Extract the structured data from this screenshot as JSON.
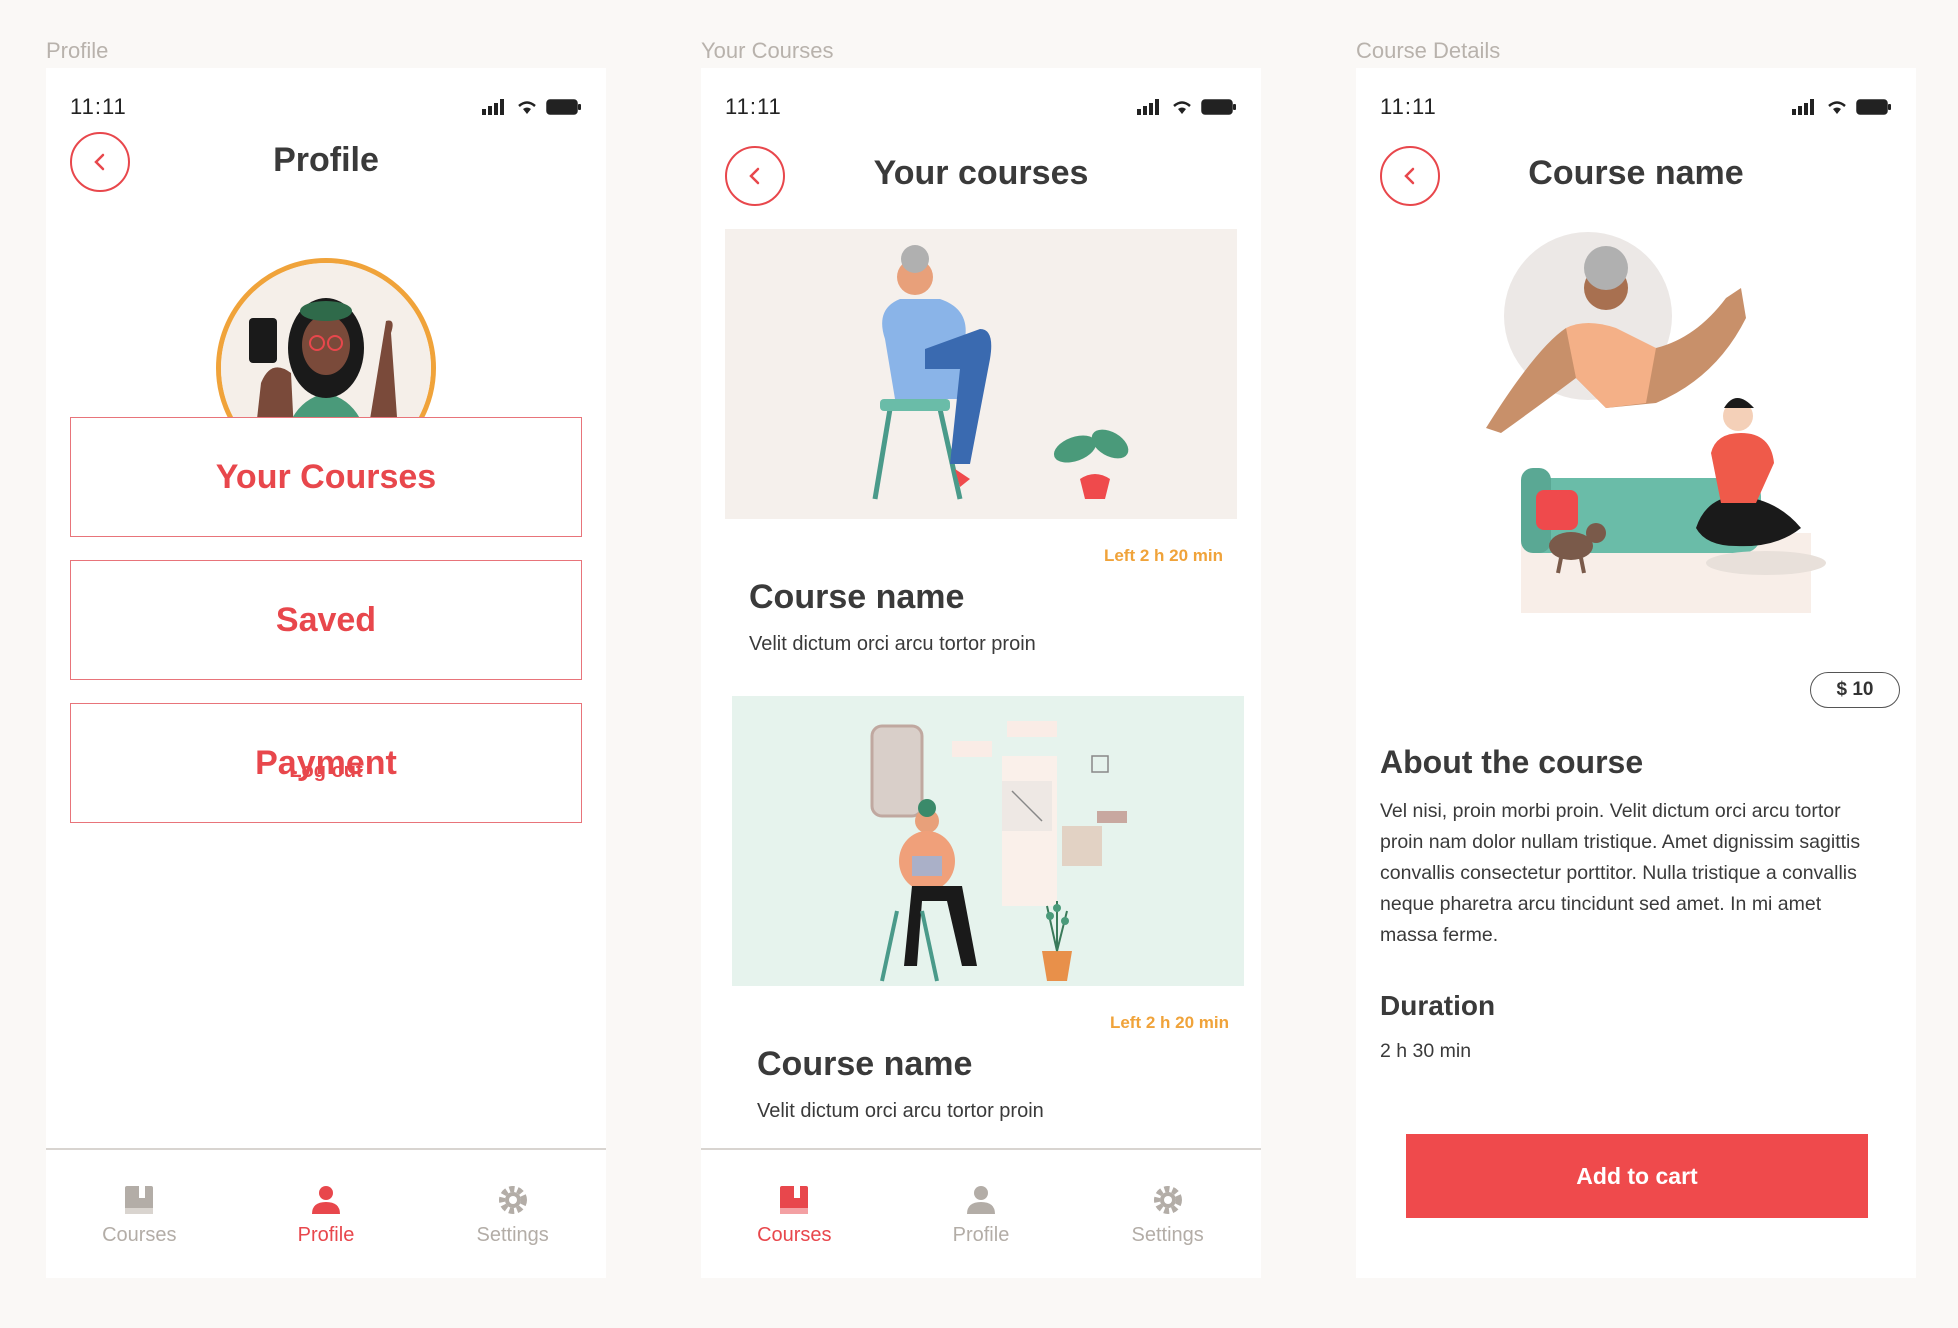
{
  "frames": {
    "profile_label": "Profile",
    "courses_label": "Your Courses",
    "details_label": "Course Details"
  },
  "status": {
    "time": "11:11"
  },
  "profile": {
    "title": "Profile",
    "menu": [
      "Your Courses",
      "Saved",
      "Payment"
    ],
    "logout": "Log out"
  },
  "courses": {
    "title": "Your courses",
    "items": [
      {
        "left": "Left 2 h 20 min",
        "name": "Course name",
        "desc": "Velit dictum orci arcu tortor proin"
      },
      {
        "left": "Left 2 h 20 min",
        "name": "Course name",
        "desc": "Velit dictum orci arcu tortor proin"
      }
    ]
  },
  "details": {
    "title": "Course name",
    "price": "$ 10",
    "about_heading": "About the course",
    "about_text": "Vel nisi, proin morbi proin. Velit dictum orci arcu tortor proin nam dolor nullam tristique. Amet dignissim sagittis convallis consectetur porttitor. Nulla tristique a convallis neque pharetra arcu tincidunt sed amet. In mi amet massa ferme.",
    "duration_heading": "Duration",
    "duration_value": "2 h 30 min",
    "cart_button": "Add to cart"
  },
  "tabs": {
    "courses": "Courses",
    "profile": "Profile",
    "settings": "Settings"
  },
  "colors": {
    "accent": "#e8474c",
    "orange": "#f0a33a",
    "inactive": "#b3ada7",
    "cart": "#ef4a4c"
  },
  "icons": [
    "chevron-left-icon",
    "signal-icon",
    "wifi-icon",
    "battery-icon",
    "book-icon",
    "user-icon",
    "gear-icon"
  ]
}
